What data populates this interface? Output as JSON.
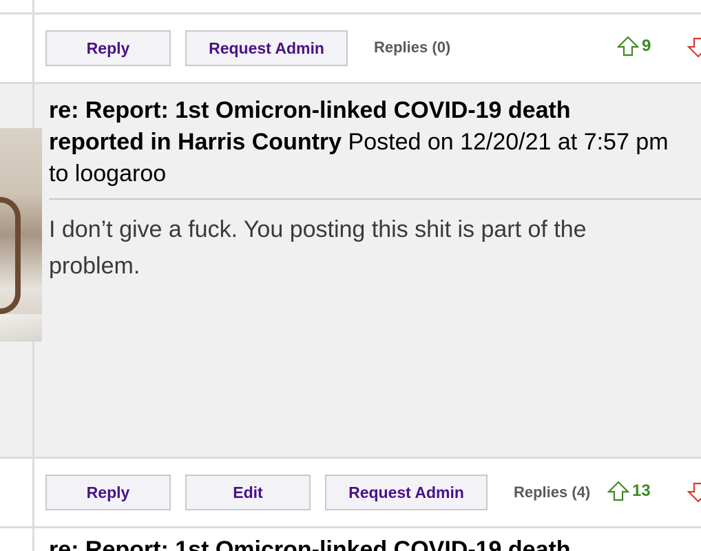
{
  "top_action_bar": {
    "reply_label": "Reply",
    "request_admin_label": "Request Admin",
    "replies_label": "Replies (0)",
    "upvote_count": "9"
  },
  "post": {
    "title": "re: Report: 1st Omicron-linked COVID-19 death reported in Harris Country",
    "meta": "Posted on 12/20/21 at 7:57 pm to loogaroo",
    "body": "I don’t give a fuck. You posting this shit is part of the problem."
  },
  "post_action_bar": {
    "reply_label": "Reply",
    "edit_label": "Edit",
    "request_admin_label": "Request Admin",
    "replies_label": "Replies (4)",
    "upvote_count": "13"
  },
  "next_post": {
    "title": "re: Report: 1st Omicron-linked COVID-19 death"
  },
  "colors": {
    "button_text": "#4b1187",
    "upvote": "#3e8a26",
    "downvote": "#d93a2b",
    "post_background": "#f0f0f0"
  },
  "icons": {
    "upvote": "arrow-up-icon",
    "downvote": "arrow-down-icon"
  }
}
